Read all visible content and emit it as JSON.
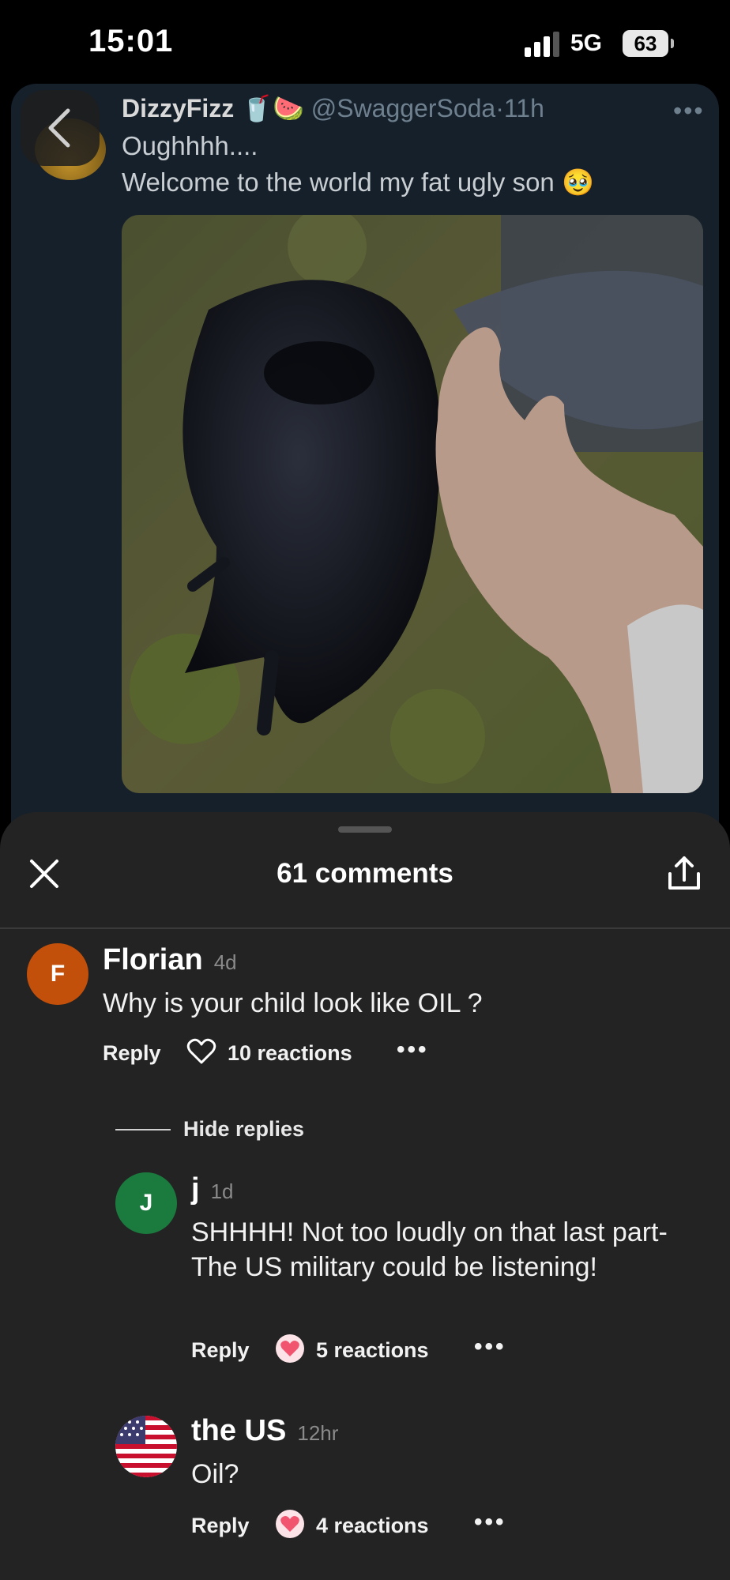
{
  "status_bar": {
    "time": "15:01",
    "network": "5G",
    "battery": "63"
  },
  "tweet": {
    "name": "DizzyFizz",
    "name_emoji": "🥤🍉",
    "handle": "@SwaggerSoda",
    "age": "11h",
    "line1": "Oughhhh....",
    "line2": "Welcome to the world my fat ugly son",
    "line2_emoji": "🥹"
  },
  "sheet": {
    "title": "61 comments"
  },
  "comments": [
    {
      "avatar_letter": "F",
      "avatar_color": "#c2500a",
      "name": "Florian",
      "time": "4d",
      "text": "Why is your child look like OIL ?",
      "reply": "Reply",
      "reactions": "10 reactions",
      "more": "•••"
    },
    {
      "avatar_letter": "J",
      "avatar_color": "#1b7a3e",
      "name": "j",
      "time": "1d",
      "text": "SHHHH! Not too loudly on that last part- The US military could be listening!",
      "reply": "Reply",
      "reactions": "5 reactions",
      "more": "•••"
    },
    {
      "avatar_letter": "",
      "avatar_color": "#ffffff",
      "name": "the US",
      "time": "12hr",
      "text": "Oil?",
      "reply": "Reply",
      "reactions": "4 reactions",
      "more": "•••"
    }
  ],
  "hide_replies": "Hide replies",
  "colors": {
    "sheet_bg": "#232323",
    "tweet_bg": "#15202b",
    "heart_reaction": "#f0546f"
  },
  "icons": [
    "back-icon",
    "close-icon",
    "share-icon",
    "heart-outline-icon",
    "heart-reaction-icon",
    "more-icon",
    "us-flag-icon"
  ]
}
